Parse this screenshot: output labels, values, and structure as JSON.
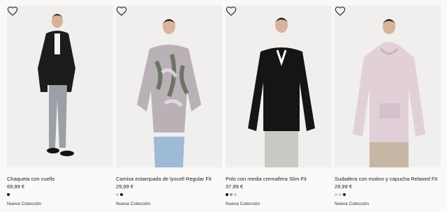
{
  "products": [
    {
      "name": "Chaqueta con cuello",
      "price": "69,99 €",
      "swatches": [
        "#111111"
      ],
      "badge": "Nueva Colección"
    },
    {
      "name": "Camisa estampada de lyocell Regular Fit",
      "price": "29,99 €",
      "swatches": [
        "#c9c3c6",
        "#111111"
      ],
      "badge": "Nueva Colección"
    },
    {
      "name": "Polo con media cremallera Slim Fit",
      "price": "37,99 €",
      "swatches": [
        "#111111",
        "#9a9a9a",
        "#c9c9c9"
      ],
      "badge": "Nueva Colección"
    },
    {
      "name": "Sudadera con motivo y capucha Relaxed Fit",
      "price": "29,99 €",
      "swatches": [
        "#d8c7cf",
        "#c9c9c9",
        "#222222"
      ],
      "badge": "Nueva Colección"
    }
  ],
  "icons": {
    "favorite": "heart-icon"
  }
}
